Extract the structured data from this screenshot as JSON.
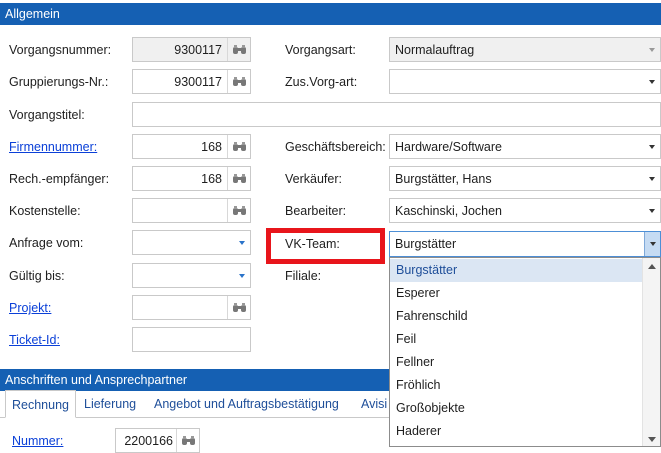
{
  "sections": {
    "general": "Allgemein",
    "addresses": "Anschriften und Ansprechpartner"
  },
  "left": {
    "vorgangsnummer": {
      "label": "Vorgangsnummer:",
      "value": "9300117"
    },
    "gruppierung": {
      "label": "Gruppierungs-Nr.:",
      "value": "9300117"
    },
    "vorgangstitel": {
      "label": "Vorgangstitel:",
      "value": ""
    },
    "firmennummer": {
      "label": "Firmennummer:",
      "value": "168"
    },
    "rechempfaenger": {
      "label": "Rech.-empfänger:",
      "value": "168"
    },
    "kostenstelle": {
      "label": "Kostenstelle:",
      "value": ""
    },
    "anfrage": {
      "label": "Anfrage vom:",
      "value": ""
    },
    "gueltig": {
      "label": "Gültig bis:",
      "value": ""
    },
    "projekt": {
      "label": "Projekt:",
      "value": ""
    },
    "ticket": {
      "label": "Ticket-Id:",
      "value": ""
    }
  },
  "right": {
    "vorgangsart": {
      "label": "Vorgangsart:",
      "value": "Normalauftrag"
    },
    "zusvorgart": {
      "label": "Zus.Vorg-art:",
      "value": ""
    },
    "geschaeftsbereich": {
      "label": "Geschäftsbereich:",
      "value": "Hardware/Software"
    },
    "verkaeufer": {
      "label": "Verkäufer:",
      "value": "Burgstätter, Hans"
    },
    "bearbeiter": {
      "label": "Bearbeiter:",
      "value": "Kaschinski, Jochen"
    },
    "vkteam": {
      "label": "VK-Team:",
      "value": "Burgstätter"
    },
    "filiale": {
      "label": "Filiale:"
    }
  },
  "vkteam_options": [
    "Burgstätter",
    "Esperer",
    "Fahrenschild",
    "Feil",
    "Fellner",
    "Fröhlich",
    "Großobjekte",
    "Haderer"
  ],
  "tabs": [
    "Rechnung",
    "Lieferung",
    "Angebot und Auftragsbestätigung",
    "Avisi"
  ],
  "address": {
    "nummer_label": "Nummer:",
    "nummer_value": "2200166"
  },
  "colors": {
    "header": "#1560b3",
    "highlight": "#e8151b",
    "link": "#0b40d8"
  }
}
